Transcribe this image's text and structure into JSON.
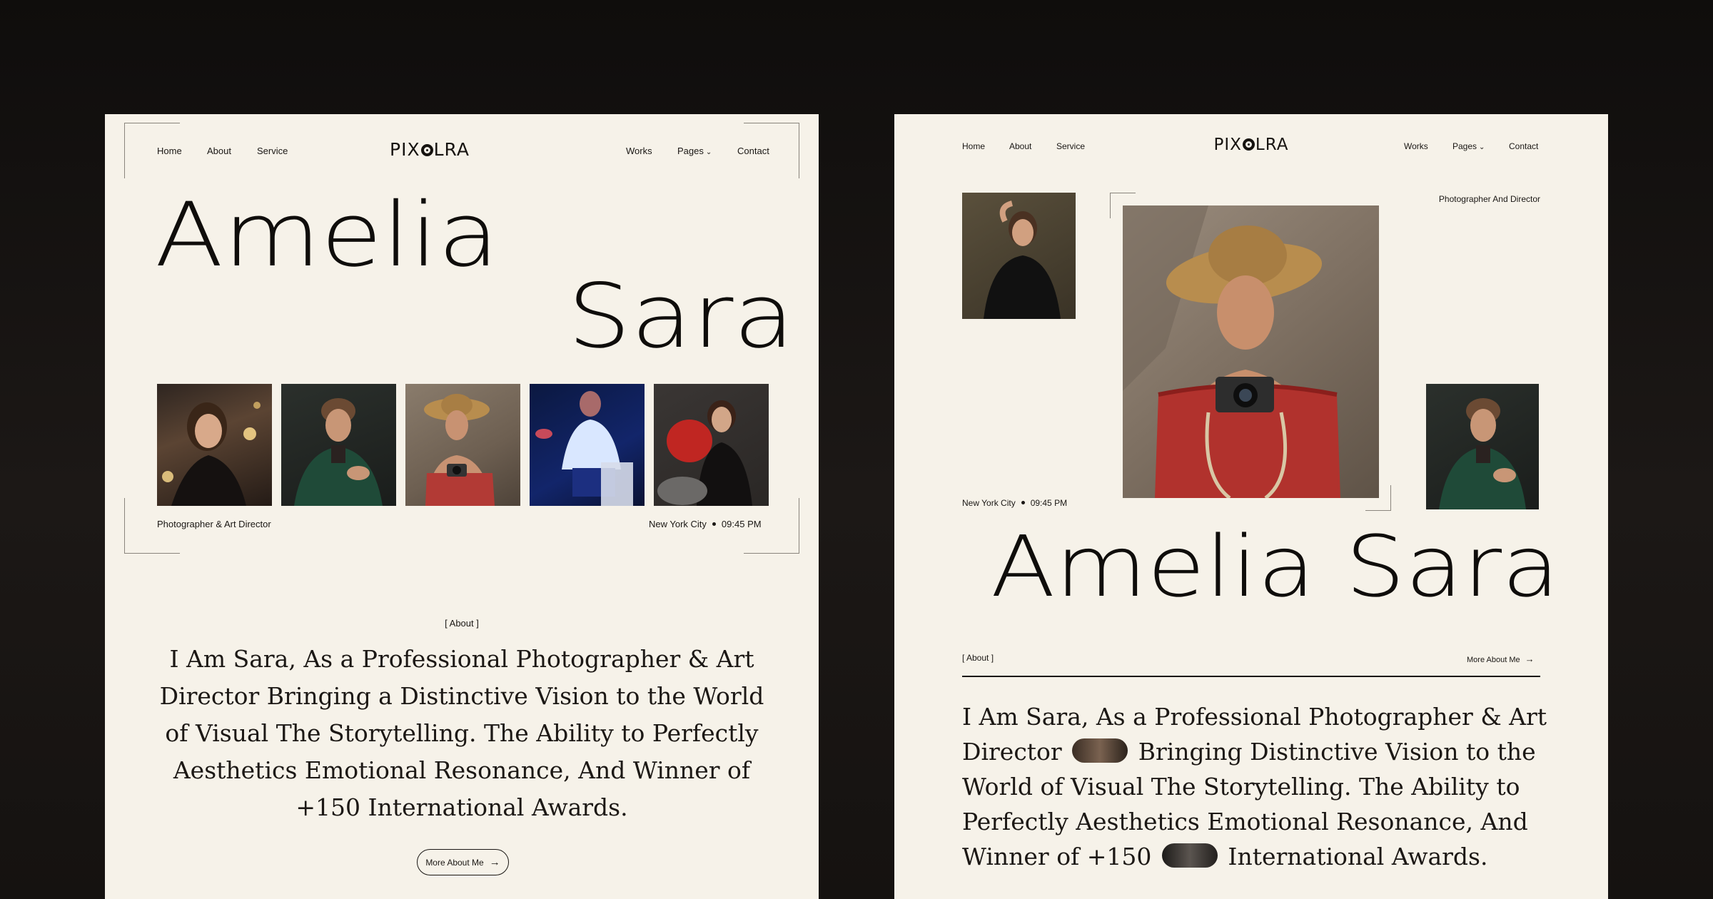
{
  "nav": {
    "home": "Home",
    "about": "About",
    "service": "Service",
    "works": "Works",
    "pages": "Pages",
    "contact": "Contact"
  },
  "brand": {
    "before": "PIX",
    "after": "LRA"
  },
  "hero": {
    "first_name": "Amelia",
    "last_name": "Sara",
    "full_name": "Amelia Sara"
  },
  "left": {
    "role": "Photographer & Art Director",
    "city": "New York City",
    "time": "09:45 PM",
    "about_tag": "[ About ]",
    "about_text": "I Am Sara, As a Professional Photographer & Art Director Bringing a Distinctive Vision to the World of Visual The Storytelling. The Ability to Perfectly Aesthetics Emotional Resonance, And Winner of +150 International Awards.",
    "button": "More About Me"
  },
  "right": {
    "role": "Photographer And Director",
    "city": "New York City",
    "time": "09:45 PM",
    "about_tag": "[ About ]",
    "more_link": "More About Me",
    "about_p1": "I Am Sara, As a Professional Photographer & Art Director",
    "about_p2": "Bringing Distinctive Vision to the World of Visual The Storytelling. The Ability to Perfectly Aesthetics Emotional Resonance, And Winner of +150",
    "about_p3": "International Awards."
  },
  "icons": {
    "logo_o": "aperture-icon",
    "dropdown": "chevron-down-icon",
    "arrow": "arrow-right-icon"
  },
  "colors": {
    "page_bg": "#f6f2e9",
    "ink": "#0f0d0b",
    "backdrop": "#141110"
  }
}
